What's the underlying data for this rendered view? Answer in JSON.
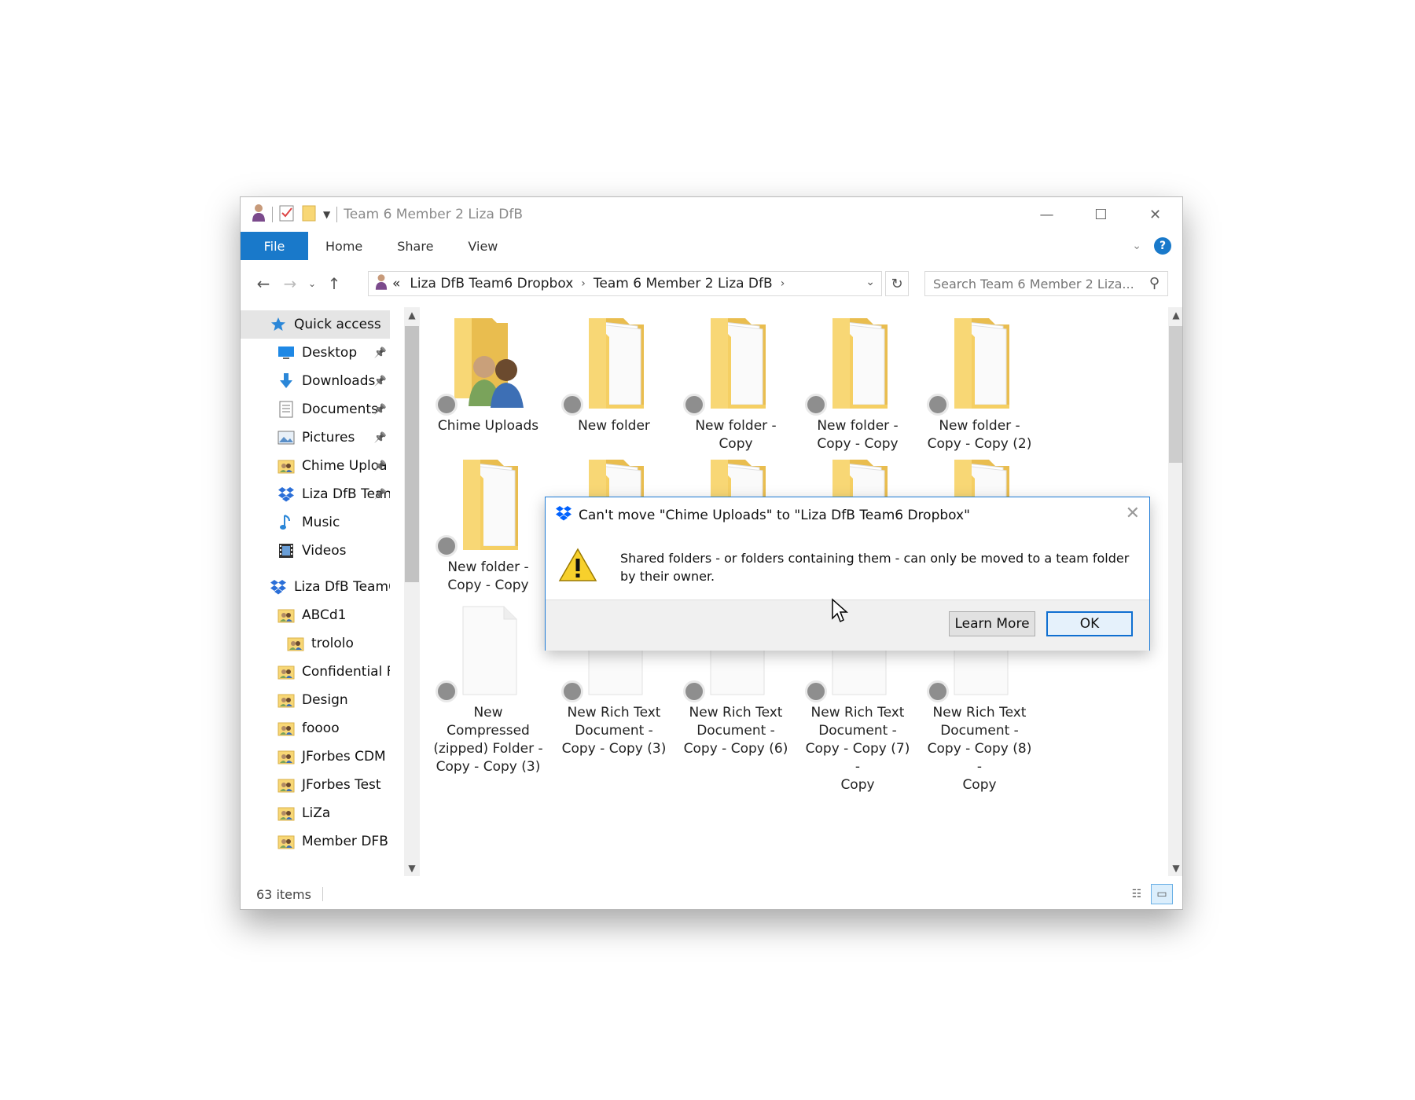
{
  "window": {
    "title": "Team 6 Member 2 Liza DfB"
  },
  "ribbon": {
    "tabs": [
      "File",
      "Home",
      "Share",
      "View"
    ]
  },
  "address": {
    "overflow": "«",
    "crumbs": [
      "Liza DfB Team6 Dropbox",
      "Team 6 Member 2 Liza DfB"
    ]
  },
  "search": {
    "placeholder": "Search Team 6 Member 2 Liza..."
  },
  "sidebar": {
    "items": [
      {
        "label": "Quick access",
        "icon": "star-icon",
        "pinned": false
      },
      {
        "label": "Desktop",
        "icon": "desktop-icon",
        "pinned": true
      },
      {
        "label": "Downloads",
        "icon": "download-arrow-icon",
        "pinned": true
      },
      {
        "label": "Documents",
        "icon": "document-icon",
        "pinned": true
      },
      {
        "label": "Pictures",
        "icon": "picture-icon",
        "pinned": true
      },
      {
        "label": "Chime Uploa",
        "icon": "shared-folder-icon",
        "pinned": true
      },
      {
        "label": "Liza DfB Tean",
        "icon": "dropbox-icon",
        "pinned": true
      },
      {
        "label": "Music",
        "icon": "music-note-icon",
        "pinned": false
      },
      {
        "label": "Videos",
        "icon": "film-icon",
        "pinned": false
      },
      {
        "label": "Liza DfB Team6 Dr",
        "icon": "dropbox-icon",
        "pinned": false
      },
      {
        "label": "ABCd1",
        "icon": "shared-folder-icon",
        "pinned": false
      },
      {
        "label": "trololo",
        "icon": "shared-folder-icon",
        "pinned": false
      },
      {
        "label": "Confidential Fol",
        "icon": "shared-folder-icon",
        "pinned": false
      },
      {
        "label": "Design",
        "icon": "shared-folder-icon",
        "pinned": false
      },
      {
        "label": "foooo",
        "icon": "shared-folder-icon",
        "pinned": false
      },
      {
        "label": "JForbes CDM Ro",
        "icon": "shared-folder-icon",
        "pinned": false
      },
      {
        "label": "JForbes Test",
        "icon": "shared-folder-icon",
        "pinned": false
      },
      {
        "label": "LiZa",
        "icon": "shared-folder-icon",
        "pinned": false
      },
      {
        "label": "Member DFB Te:",
        "icon": "shared-folder-icon",
        "pinned": false
      }
    ]
  },
  "files": [
    {
      "name": "Chime Uploads",
      "icon": "shared-folder-icon"
    },
    {
      "name": "New folder",
      "icon": "folder-icon"
    },
    {
      "name": "New folder -\nCopy",
      "icon": "folder-icon"
    },
    {
      "name": "New folder -\nCopy - Copy",
      "icon": "folder-icon"
    },
    {
      "name": "New folder -\nCopy - Copy (2)",
      "icon": "folder-icon"
    },
    {
      "name": "New folder -\nCopy - Copy",
      "icon": "folder-icon"
    },
    {
      "name": "New Compressed\n(zipped) Folder -\nCopy - Copy (3)",
      "icon": "file-icon"
    },
    {
      "name": "New Rich Text\nDocument -\nCopy - Copy (3)",
      "icon": "file-icon"
    },
    {
      "name": "New Rich Text\nDocument -\nCopy - Copy (6)",
      "icon": "file-icon"
    },
    {
      "name": "New Rich Text\nDocument -\nCopy - Copy (7) -\nCopy",
      "icon": "file-icon"
    },
    {
      "name": "New Rich Text\nDocument -\nCopy - Copy (8) -\nCopy",
      "icon": "file-icon"
    }
  ],
  "status": {
    "item_count": "63 items"
  },
  "dialog": {
    "title": "Can't move \"Chime Uploads\" to \"Liza DfB Team6 Dropbox\"",
    "message": "Shared folders - or folders containing them - can only be moved to a team folder by their owner.",
    "learn_more": "Learn More",
    "ok": "OK"
  },
  "colors": {
    "accent": "#1979ca",
    "folder": "#f8d775",
    "dialog_border": "#1e7bd6"
  }
}
